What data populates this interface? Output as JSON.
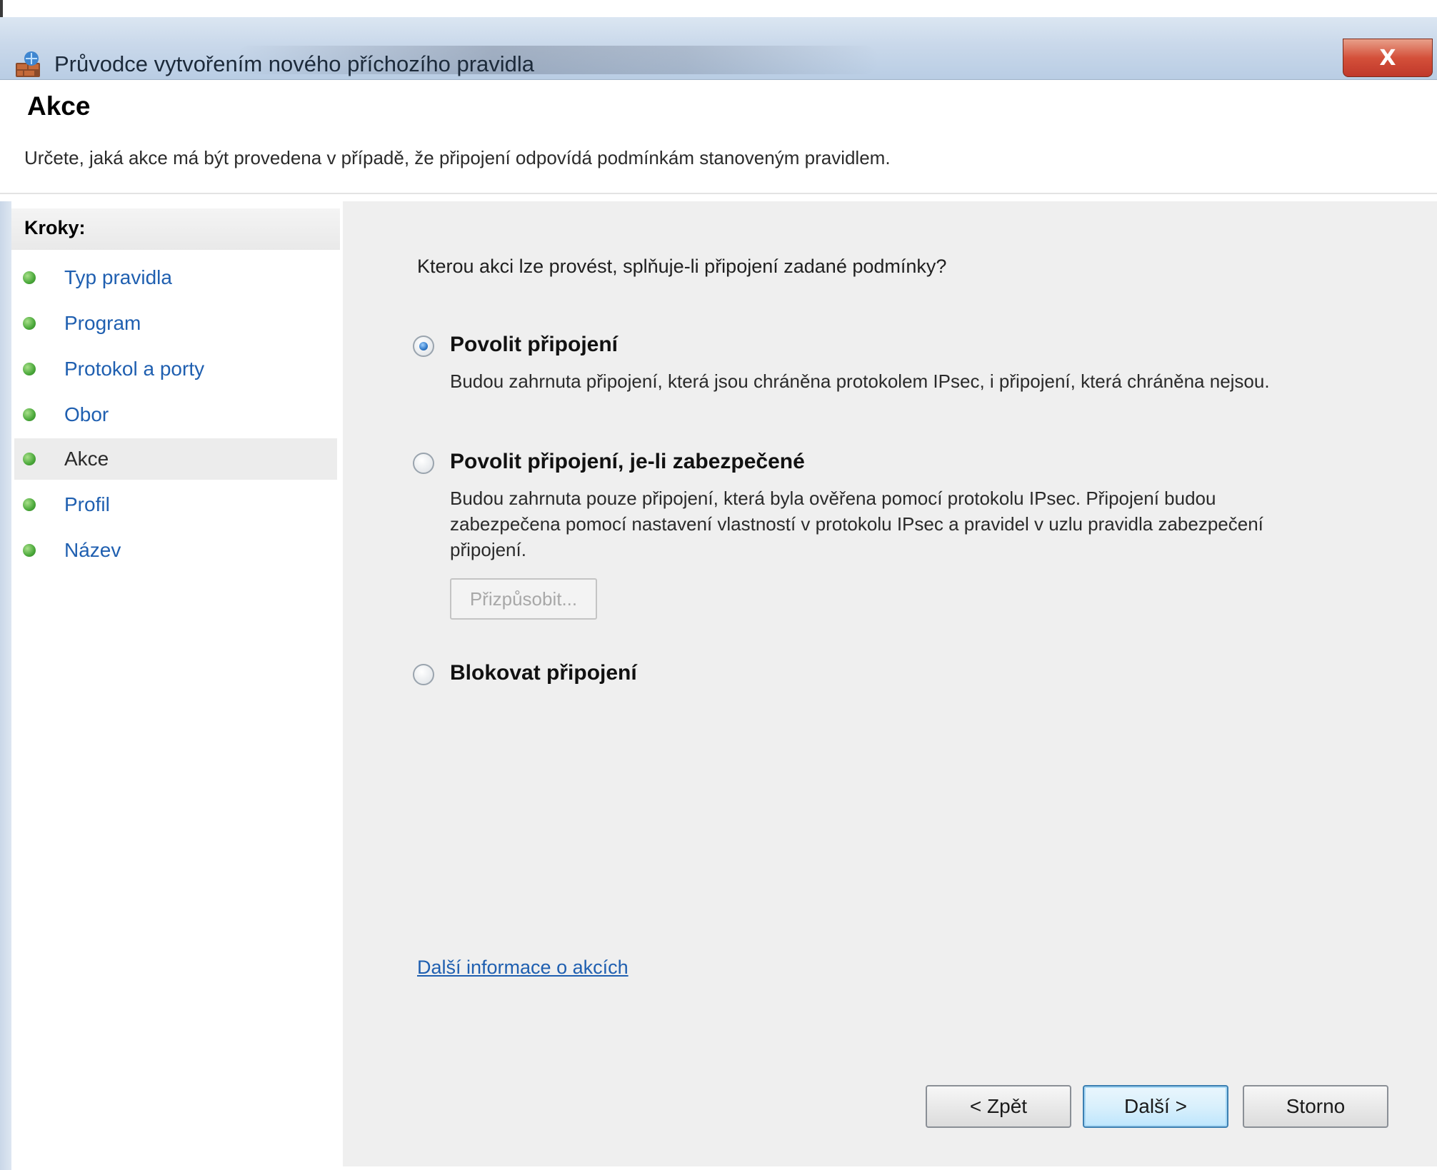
{
  "window": {
    "title": "Průvodce vytvořením nového příchozího pravidla",
    "close_label": "X"
  },
  "header": {
    "title": "Akce",
    "subtitle": "Určete, jaká akce má být provedena v případě, že připojení odpovídá podmínkám stanoveným pravidlem."
  },
  "sidebar": {
    "steps_label": "Kroky:",
    "items": [
      {
        "label": "Typ pravidla",
        "active": false
      },
      {
        "label": "Program",
        "active": false
      },
      {
        "label": "Protokol a porty",
        "active": false
      },
      {
        "label": "Obor",
        "active": false
      },
      {
        "label": "Akce",
        "active": true
      },
      {
        "label": "Profil",
        "active": false
      },
      {
        "label": "Název",
        "active": false
      }
    ]
  },
  "main": {
    "question": "Kterou akci lze provést, splňuje-li připojení zadané podmínky?",
    "options": [
      {
        "title": "Povolit připojení",
        "description": "Budou zahrnuta připojení, která jsou chráněna protokolem IPsec, i připojení, která chráněna nejsou.",
        "selected": true
      },
      {
        "title": "Povolit připojení, je-li zabezpečené",
        "description": "Budou zahrnuta pouze připojení, která byla ověřena pomocí protokolu IPsec. Připojení budou zabezpečena pomocí nastavení vlastností v protokolu IPsec a pravidel v uzlu pravidla zabezpečení připojení.",
        "selected": false
      },
      {
        "title": "Blokovat připojení",
        "description": "",
        "selected": false
      }
    ],
    "customize_label": "Přizpůsobit...",
    "more_info_link": "Další informace o akcích"
  },
  "footer": {
    "back_label": "< Zpět",
    "next_label": "Další >",
    "cancel_label": "Storno"
  },
  "colors": {
    "link": "#1f5fb0",
    "content_bg": "#efefef",
    "close_button": "#c0382a",
    "step_dot": "#4aa83a"
  }
}
